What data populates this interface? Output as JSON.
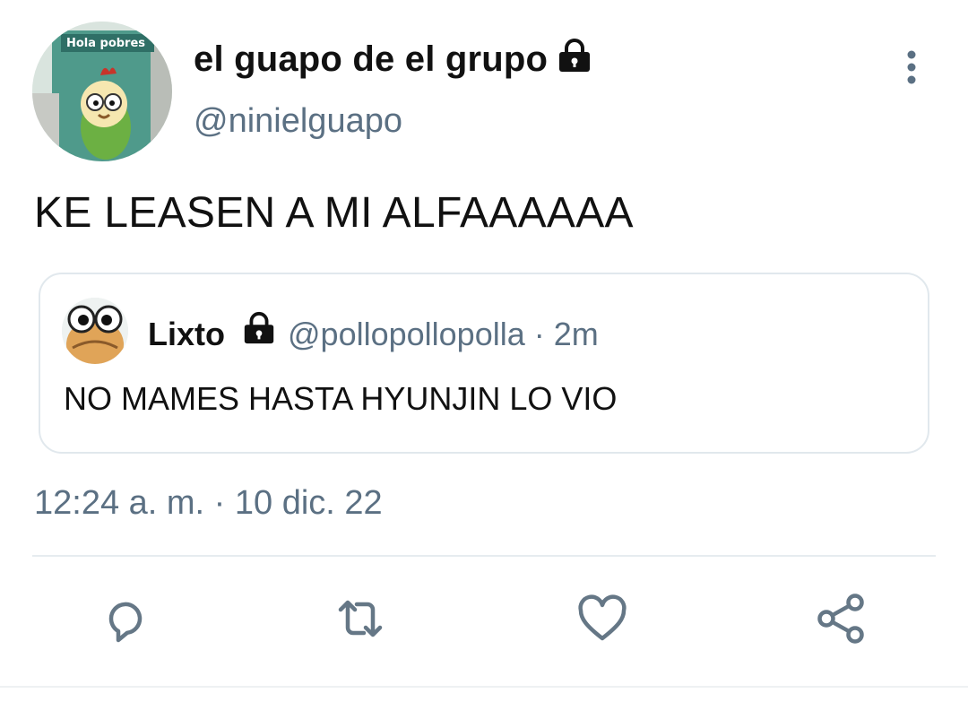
{
  "author": {
    "display_name": "el guapo de el grupo",
    "handle": "@ninielguapo",
    "avatar_caption": "Hola pobres",
    "protected": true
  },
  "tweet": {
    "text": "KE LEASEN A MI ALFAAAAAA",
    "timestamp": "12:24 a. m. · 10 dic. 22"
  },
  "quoted_tweet": {
    "display_name": "Lixto",
    "meta": "@pollopollopolla · 2m",
    "protected": true,
    "text": "NO MAMES HASTA HYUNJIN LO VIO"
  },
  "actions": [
    {
      "name": "reply",
      "icon": "reply-icon"
    },
    {
      "name": "retweet",
      "icon": "retweet-icon"
    },
    {
      "name": "like",
      "icon": "heart-icon"
    },
    {
      "name": "share",
      "icon": "share-icon"
    }
  ],
  "colors": {
    "text_primary": "#111111",
    "text_secondary": "#5b7083",
    "border": "#e1e8ed",
    "icon": "#657786"
  }
}
